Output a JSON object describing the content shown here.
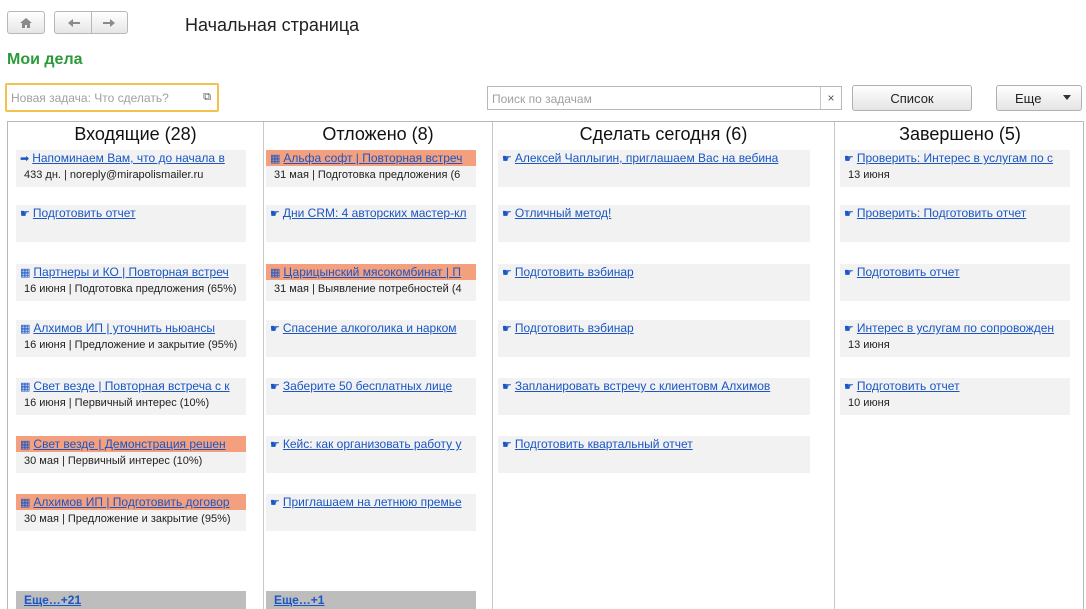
{
  "nav": {
    "home_icon": "home-icon",
    "back_icon": "arrow-left-icon",
    "forward_icon": "arrow-right-icon"
  },
  "page_title": "Начальная страница",
  "section_title": "Мои дела",
  "new_task": {
    "placeholder": "Новая задача: Что сделать?",
    "value": ""
  },
  "search": {
    "placeholder": "Поиск по задачам",
    "value": "",
    "clear_label": "×"
  },
  "buttons": {
    "list": "Список",
    "more": "Еще"
  },
  "colors": {
    "accent_green": "#2b9a3a",
    "highlight": "#f4a07e",
    "link": "#1a56c4",
    "focus": "#f2c24d"
  },
  "columns": [
    {
      "title": "Входящие (28)",
      "more": "Еще…+21",
      "cards": [
        {
          "icon": "➡",
          "title": "Напоминаем Вам, что до начала в",
          "sub": "433 дн. | noreply@mirapolismailer.ru",
          "hl": false
        },
        {
          "icon": "☛",
          "title": "Подготовить отчет",
          "sub": "",
          "hl": false
        },
        {
          "icon": "▦",
          "title": "Партнеры и КО | Повторная встреч",
          "sub": "16 июня | Подготовка предложения (65%)",
          "hl": false
        },
        {
          "icon": "▦",
          "title": "Алхимов ИП | уточнить ньюансы",
          "sub": "16 июня | Предложение и закрытие (95%)",
          "hl": false
        },
        {
          "icon": "▦",
          "title": "Свет везде | Повторная встреча с к",
          "sub": "16 июня | Первичный интерес (10%)",
          "hl": false
        },
        {
          "icon": "▦",
          "title": "Свет везде | Демонстрация решен",
          "sub": "30 мая | Первичный интерес (10%)",
          "hl": true
        },
        {
          "icon": "▦",
          "title": "Алхимов ИП | Подготовить договор",
          "sub": "30 мая | Предложение и закрытие (95%)",
          "hl": true
        }
      ]
    },
    {
      "title": "Отложено (8)",
      "more": "Еще…+1",
      "cards": [
        {
          "icon": "▦",
          "title": "Альфа софт | Повторная встреч",
          "sub": "31 мая | Подготовка предложения (6",
          "hl": true
        },
        {
          "icon": "☛",
          "title": "Дни CRM: 4 авторских мастер-кл",
          "sub": "",
          "hl": false
        },
        {
          "icon": "▦",
          "title": "Царицынский мясокомбинат | П",
          "sub": "31 мая | Выявление потребностей (4",
          "hl": true
        },
        {
          "icon": "☛",
          "title": "Спасение алкоголика и нарком",
          "sub": "",
          "hl": false
        },
        {
          "icon": "☛",
          "title": "Заберите  50  бесплатных  лице",
          "sub": "",
          "hl": false
        },
        {
          "icon": "☛",
          "title": "Кейс: как организовать работу у",
          "sub": "",
          "hl": false
        },
        {
          "icon": "☛",
          "title": "Приглашаем на летнюю премье",
          "sub": "",
          "hl": false
        }
      ]
    },
    {
      "title": "Сделать сегодня (6)",
      "more": "",
      "cards": [
        {
          "icon": "☛",
          "title": "Алексей  Чаплыгин,  приглашаем  Вас  на  вебина",
          "sub": "",
          "hl": false
        },
        {
          "icon": "☛",
          "title": "Отличный метод!",
          "sub": "",
          "hl": false
        },
        {
          "icon": "☛",
          "title": "Подготовить вэбинар",
          "sub": "",
          "hl": false
        },
        {
          "icon": "☛",
          "title": "Подготовить вэбинар",
          "sub": "",
          "hl": false
        },
        {
          "icon": "☛",
          "title": "Запланировать встречу с клиентовм Алхимов",
          "sub": "",
          "hl": false
        },
        {
          "icon": "☛",
          "title": "Подготовить квартальный отчет",
          "sub": "",
          "hl": false
        }
      ]
    },
    {
      "title": "Завершено (5)",
      "more": "",
      "cards": [
        {
          "icon": "☛",
          "title": "Проверить: Интерес в услугам по с",
          "sub": "13 июня",
          "hl": false
        },
        {
          "icon": "☛",
          "title": "Проверить: Подготовить отчет",
          "sub": "",
          "hl": false
        },
        {
          "icon": "☛",
          "title": "Подготовить отчет",
          "sub": "",
          "hl": false
        },
        {
          "icon": "☛",
          "title": "Интерес в услугам по сопровожден",
          "sub": "13 июня",
          "hl": false
        },
        {
          "icon": "☛",
          "title": "Подготовить отчет",
          "sub": "10 июня",
          "hl": false
        }
      ]
    }
  ]
}
